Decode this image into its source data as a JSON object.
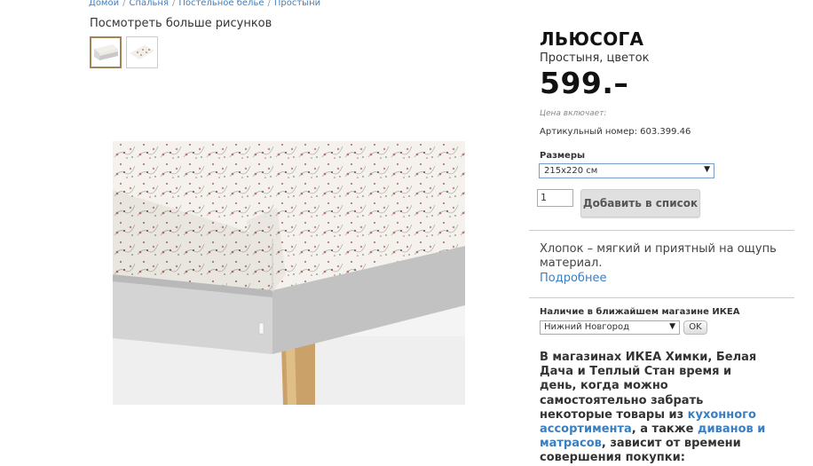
{
  "breadcrumb": [
    "Домой",
    "Спальня",
    "Постельное белье",
    "Простыни"
  ],
  "gallery": {
    "more_label": "Посмотреть больше рисунков"
  },
  "product": {
    "name": "ЛЬЮСОГА",
    "subtitle": "Простыня, цветок",
    "price": "599.–",
    "price_note": "Цена включает:",
    "article": "Артикульный номер: 603.399.46"
  },
  "sizes": {
    "label": "Размеры",
    "selected": "215x220 см"
  },
  "cart": {
    "quantity": "1",
    "add_label": "Добавить в список"
  },
  "description": {
    "text": "Хлопок – мягкий и приятный на ощупь материал.",
    "more_link": "Подробнее"
  },
  "availability": {
    "label": "Наличие в ближайшем магазине ИКЕА",
    "store": "Нижний Новгород",
    "ok_label": "OK"
  },
  "promo": {
    "part1": "В магазинах ИКЕА Химки, Белая Дача и Теплый Стан время и день, когда можно самостоятельно забрать некоторые товары из ",
    "link1": "кухонного ассортимента",
    "part2": ", а также ",
    "link2": "диванов и матрасов",
    "part3": ", зависит от времени совершения покупки:"
  },
  "colors": {
    "link": "#3a7fc1",
    "thumb_active_border": "#a08454"
  },
  "icons": {
    "select_arrow": "dropdown-arrow-icon"
  }
}
